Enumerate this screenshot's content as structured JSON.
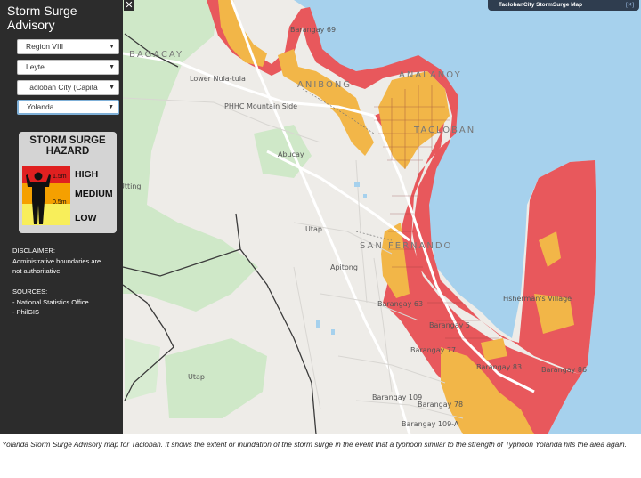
{
  "sidebar": {
    "title": "Storm Surge Advisory",
    "close_symbol": "✕",
    "dropdowns": [
      {
        "value": "Region VIII"
      },
      {
        "value": "Leyte"
      },
      {
        "value": "Tacloban City (Capita"
      },
      {
        "value": "Yolanda"
      }
    ],
    "legend": {
      "title": "STORM SURGE HAZARD",
      "levels": [
        {
          "label": "HIGH",
          "color": "#e02020"
        },
        {
          "label": "MEDIUM",
          "color": "#f5a000"
        },
        {
          "label": "LOW",
          "color": "#f8ee5a"
        }
      ],
      "marks": [
        "1.5m",
        "0.5m"
      ],
      "icon": "person-silhouette-icon"
    },
    "disclaimer_heading": "DISCLAIMER:",
    "disclaimer_text": "Administrative boundaries are not authoritative.",
    "sources_heading": "SOURCES:",
    "sources": [
      "- National Statistics Office",
      "- PhilGIS"
    ]
  },
  "map_title": "TaclobanCity StormSurge Map",
  "map_title_icon": "expand-icon",
  "map": {
    "districts": [
      "BAGACAY",
      "ANIBONG",
      "ANALANOY",
      "TACLOBAN",
      "SAN FERNANDO"
    ],
    "places": [
      "Barangay 69",
      "Lower Nula-tula",
      "PHHC Mountain Side",
      "Abucay",
      "Utting",
      "Utap",
      "Apitong",
      "Barangay 63",
      "Barangay 5",
      "Barangay 77",
      "Barangay 83",
      "Barangay 86",
      "Fisherman's Village",
      "Barangay 109",
      "Barangay 78",
      "Barangay 109-A",
      "Utap"
    ]
  },
  "caption": "Yolanda Storm Surge Advisory map for Tacloban. It shows the extent or inundation of the storm surge in the event that a typhoon similar to the strength of Typhoon Yolanda hits the area again."
}
